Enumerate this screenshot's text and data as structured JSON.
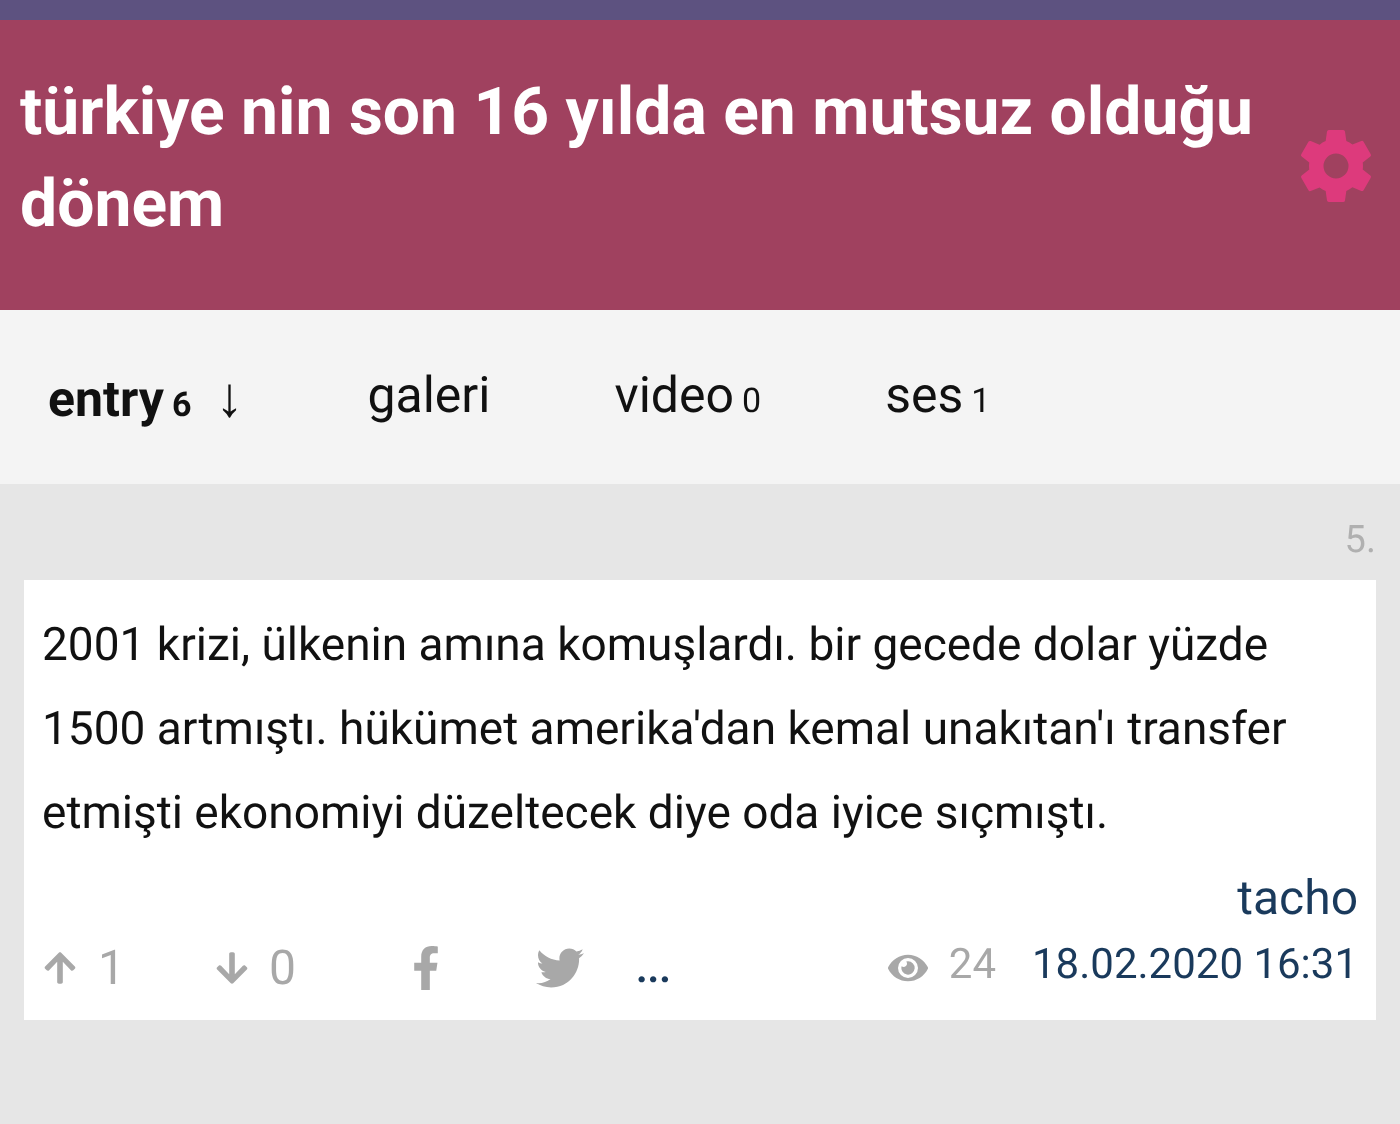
{
  "header": {
    "title": "türkiye nin son 16 yılda en mutsuz olduğu dönem"
  },
  "tabs": [
    {
      "label": "entry",
      "count": "6",
      "sort_arrow": "↓",
      "selected": true
    },
    {
      "label": "galeri",
      "selected": false
    },
    {
      "label": "video",
      "count": "0",
      "selected": false
    },
    {
      "label": "ses",
      "count": "1",
      "selected": false
    }
  ],
  "entry": {
    "number": "5.",
    "text": "2001 krizi, ülkenin amına komuşlardı. bir gecede dolar yüzde 1500 artmıştı. hükümet amerika'dan kemal unakıtan'ı transfer etmişti ekonomiyi düzeltecek diye oda iyice sıçmıştı.",
    "author": "tacho",
    "upvotes": "1",
    "downvotes": "0",
    "more": "...",
    "views": "24",
    "date": "18.02.2020 16:31"
  }
}
